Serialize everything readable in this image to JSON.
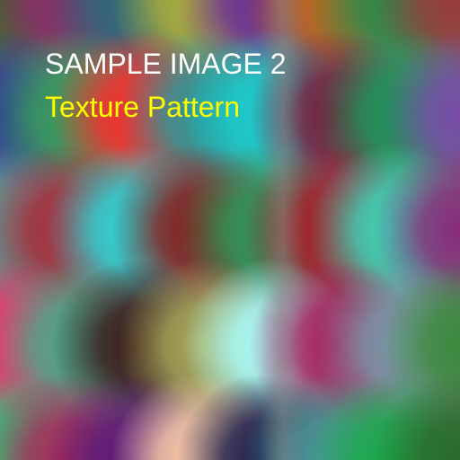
{
  "image": {
    "title": "SAMPLE IMAGE 2",
    "subtitle": "Texture Pattern",
    "colors": {
      "title": "#ffffff",
      "subtitle": "#ffff00"
    },
    "texture": {
      "description_colors": [
        [
          "#3a6a20",
          "#8a2a6a",
          "#2a6a7a",
          "#b0b03a",
          "#6a2a9a",
          "#c06a1a",
          "#2a8a4a",
          "#9a3a3a"
        ],
        [
          "#2a3a9a",
          "#3aa05a",
          "#ff2a2a",
          "#2a9a9a",
          "#1ad0d0",
          "#7a1a3a",
          "#1a9a5a",
          "#7a4aaa"
        ],
        [
          "#5aa09a",
          "#aa2a3a",
          "#2adada",
          "#8a1a1a",
          "#2a9a5a",
          "#aa1a2a",
          "#3adaba",
          "#8a2a7a"
        ],
        [
          "#ff2a6a",
          "#4aaa8a",
          "#3a1a1a",
          "#aaaa5a",
          "#aaffff",
          "#aa1a5a",
          "#7a9aaa",
          "#3a8a3a"
        ],
        [
          "#2ad07a",
          "#aa2a5a",
          "#5a1a7a",
          "#ffd0aa",
          "#1a1a4a",
          "#4a9a9a",
          "#1aaa4a",
          "#2a6a2a"
        ]
      ]
    }
  }
}
